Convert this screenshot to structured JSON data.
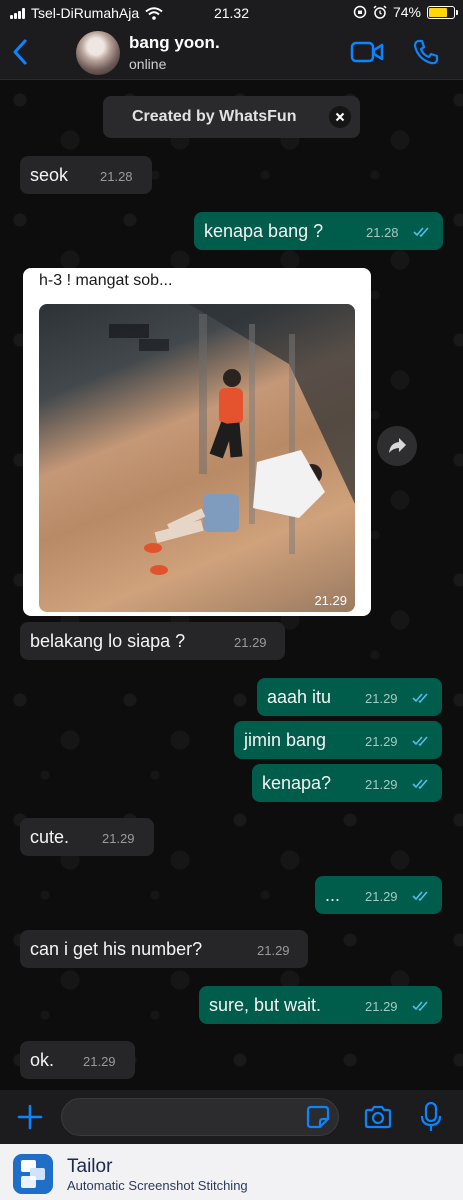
{
  "status_bar": {
    "carrier": "Tsel-DiRumahAja",
    "time": "21.32",
    "battery": "74%",
    "battery_level": 0.74
  },
  "header": {
    "contact_name": "bang yoon.",
    "contact_status": "online"
  },
  "banner": {
    "text": "Created by WhatsFun"
  },
  "messages": [
    {
      "dir": "in",
      "text": "seok",
      "time": "21.28"
    },
    {
      "dir": "out",
      "text": "kenapa bang ?",
      "time": "21.28"
    },
    {
      "dir": "in",
      "caption": "h-3 ! mangat sob...",
      "time": "21.29",
      "type": "photo"
    },
    {
      "dir": "in",
      "text": "belakang lo siapa ?",
      "time": "21.29"
    },
    {
      "dir": "out",
      "text": "aaah itu",
      "time": "21.29"
    },
    {
      "dir": "out",
      "text": "jimin bang",
      "time": "21.29"
    },
    {
      "dir": "out",
      "text": "kenapa?",
      "time": "21.29"
    },
    {
      "dir": "in",
      "text": "cute.",
      "time": "21.29"
    },
    {
      "dir": "out",
      "text": "...",
      "time": "21.29"
    },
    {
      "dir": "in",
      "text": "can i get his number?",
      "time": "21.29"
    },
    {
      "dir": "out",
      "text": "sure, but wait.",
      "time": "21.29"
    },
    {
      "dir": "in",
      "text": "ok.",
      "time": "21.29"
    }
  ],
  "input": {
    "placeholder": ""
  },
  "footer": {
    "app_name": "Tailor",
    "subtitle": "Automatic Screenshot Stitching"
  },
  "colors": {
    "incoming_bubble": "#262628",
    "outgoing_bubble": "#005c4b",
    "accent": "#0a84ff",
    "read_ticks": "#53bdeb",
    "battery": "#ffd60a"
  }
}
